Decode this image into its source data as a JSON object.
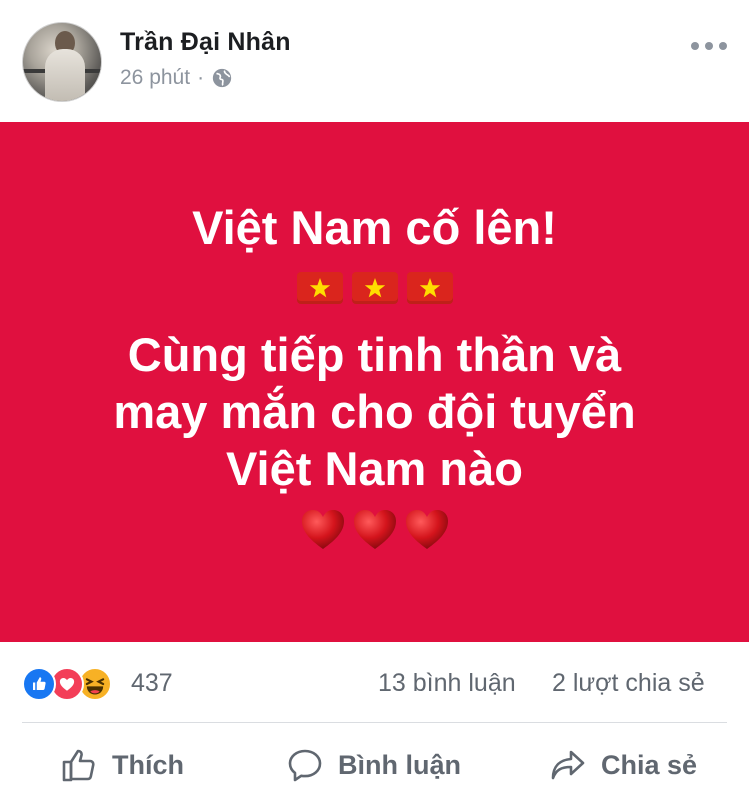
{
  "post": {
    "author": "Trần Đại Nhân",
    "time": "26 phút",
    "separator": "·",
    "privacy_icon": "globe-icon",
    "menu_icon": "more-options-icon",
    "background_color": "#e0103f",
    "text_line_1": "Việt Nam cố lên!",
    "flag_emoji_icon": "vietnam-flag-icon",
    "text_line_2": "Cùng tiếp tinh thần và",
    "text_line_3": "may mắn cho đội tuyển",
    "text_line_4": "Việt Nam nào",
    "heart_emoji_icon": "red-heart-icon"
  },
  "stats": {
    "reaction_icons": [
      "like-icon",
      "love-icon",
      "haha-icon"
    ],
    "reaction_count": "437",
    "comments": "13 bình luận",
    "shares": "2 lượt chia sẻ"
  },
  "actions": {
    "like_label": "Thích",
    "comment_label": "Bình luận",
    "share_label": "Chia sẻ"
  },
  "colors": {
    "text_primary": "#1c1e21",
    "text_secondary": "#606770",
    "like_blue": "#1877f2",
    "love_red": "#f33e58",
    "haha_yellow": "#f7b125"
  }
}
